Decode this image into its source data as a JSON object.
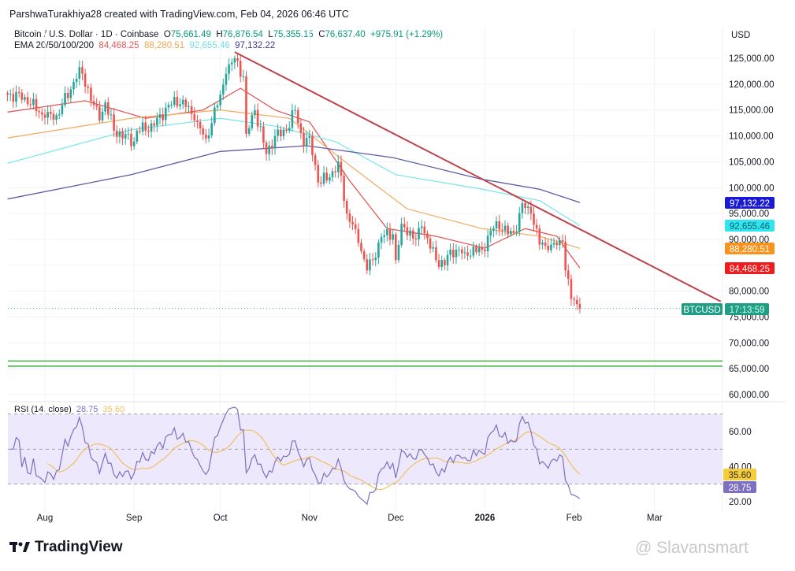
{
  "header": {
    "credit": "ParshwaTurakhiya28 created with TradingView.com, Feb 04, 2026 06:46 UTC"
  },
  "legend": {
    "symbol": "Bitcoin / U.S. Dollar · 1D · Coinbase",
    "o_label": "O",
    "o": "75,661.49",
    "h_label": "H",
    "h": "76,876.54",
    "l_label": "L",
    "l": "75,355.15",
    "c_label": "C",
    "c": "76,637.40",
    "change": "+975.91 (+1.29%)",
    "ema_label": "EMA 20/50/100/200",
    "ema20": "84,468.25",
    "ema50": "88,280.51",
    "ema100": "92,655.46",
    "ema200": "97,132.22"
  },
  "rsi_legend": {
    "label": "RSI (14, close)",
    "rsi": "28.75",
    "ma": "35.60"
  },
  "price_axis": {
    "currency": "USD",
    "ticks": [
      "125,000.00",
      "120,000.00",
      "115,000.00",
      "110,000.00",
      "105,000.00",
      "100,000.00",
      "95,000.00",
      "90,000.00",
      "80,000.00",
      "75,000.00",
      "70,000.00",
      "65,000.00",
      "60,000.00"
    ],
    "badges": {
      "ema200": "97,132.22",
      "ema100": "92,655.46",
      "ema50": "88,280.51",
      "ema20": "84,468.25",
      "symbol": "BTCUSD",
      "countdown": "17:13:59"
    }
  },
  "rsi_axis": {
    "ticks": [
      "60.00",
      "40.00",
      "20.00"
    ],
    "badges": {
      "ma": "35.60",
      "rsi": "28.75"
    }
  },
  "time_axis": {
    "labels": [
      "Aug",
      "Sep",
      "Oct",
      "Nov",
      "Dec",
      "2026",
      "Feb",
      "Mar"
    ]
  },
  "branding": {
    "logo": "TradingView",
    "watermark": "@ Slavansmart"
  },
  "colors": {
    "up": "#26a69a",
    "down": "#ef5350",
    "ema20": "#e05a5a",
    "ema50": "#f2b06a",
    "ema100": "#7fe6ea",
    "ema200": "#5c5aa6",
    "trendline": "#c0404a",
    "support": "#3cb043",
    "rsi": "#7e6fc0",
    "rsi_ma": "#f0c060",
    "rsi_bg": "#ede8fb"
  },
  "chart_data": [
    {
      "type": "candlestick",
      "title": "Bitcoin / U.S. Dollar · 1D · Coinbase",
      "ylabel": "USD",
      "ylim": [
        60000,
        127000
      ],
      "grid": true,
      "close_keypoints": [
        [
          "2025-07-19",
          118000
        ],
        [
          "2025-07-25",
          117500
        ],
        [
          "2025-08-01",
          113500
        ],
        [
          "2025-08-05",
          114000
        ],
        [
          "2025-08-10",
          119000
        ],
        [
          "2025-08-13",
          123300
        ],
        [
          "2025-08-18",
          116000
        ],
        [
          "2025-08-20",
          113000
        ],
        [
          "2025-08-22",
          116500
        ],
        [
          "2025-08-25",
          111000
        ],
        [
          "2025-09-01",
          108900
        ],
        [
          "2025-09-02",
          111000
        ],
        [
          "2025-09-08",
          112000
        ],
        [
          "2025-09-13",
          116000
        ],
        [
          "2025-09-18",
          117000
        ],
        [
          "2025-09-22",
          113000
        ],
        [
          "2025-09-26",
          109500
        ],
        [
          "2025-10-01",
          118000
        ],
        [
          "2025-10-03",
          122000
        ],
        [
          "2025-10-06",
          125000
        ],
        [
          "2025-10-09",
          121500
        ],
        [
          "2025-10-10",
          110400
        ],
        [
          "2025-10-13",
          115000
        ],
        [
          "2025-10-17",
          106500
        ],
        [
          "2025-10-20",
          110000
        ],
        [
          "2025-10-24",
          111000
        ],
        [
          "2025-10-27",
          115000
        ],
        [
          "2025-10-30",
          108000
        ],
        [
          "2025-11-01",
          110000
        ],
        [
          "2025-11-04",
          101000
        ],
        [
          "2025-11-08",
          102000
        ],
        [
          "2025-11-11",
          105000
        ],
        [
          "2025-11-14",
          95000
        ],
        [
          "2025-11-17",
          92000
        ],
        [
          "2025-11-21",
          84000
        ],
        [
          "2025-11-23",
          86000
        ],
        [
          "2025-11-26",
          90500
        ],
        [
          "2025-11-30",
          91000
        ],
        [
          "2025-12-01",
          86000
        ],
        [
          "2025-12-03",
          93000
        ],
        [
          "2025-12-08",
          90000
        ],
        [
          "2025-12-10",
          92500
        ],
        [
          "2025-12-15",
          86000
        ],
        [
          "2025-12-18",
          85000
        ],
        [
          "2025-12-20",
          88000
        ],
        [
          "2025-12-25",
          87500
        ],
        [
          "2025-12-31",
          88000
        ],
        [
          "2026-01-05",
          93500
        ],
        [
          "2026-01-09",
          91000
        ],
        [
          "2026-01-12",
          91500
        ],
        [
          "2026-01-14",
          97000
        ],
        [
          "2026-01-17",
          95000
        ],
        [
          "2026-01-20",
          89000
        ],
        [
          "2026-01-24",
          89000
        ],
        [
          "2026-01-28",
          89500
        ],
        [
          "2026-01-29",
          84000
        ],
        [
          "2026-01-31",
          78500
        ],
        [
          "2026-02-02",
          77500
        ],
        [
          "2026-02-03",
          76637.4
        ]
      ],
      "ema": [
        {
          "name": "EMA 20",
          "points": [
            [
              "2025-07-19",
              114600
            ],
            [
              "2025-08-15",
              116800
            ],
            [
              "2025-09-05",
              113400
            ],
            [
              "2025-09-25",
              115000
            ],
            [
              "2025-10-08",
              119200
            ],
            [
              "2025-10-20",
              115000
            ],
            [
              "2025-11-01",
              112700
            ],
            [
              "2025-11-15",
              101300
            ],
            [
              "2025-11-28",
              92100
            ],
            [
              "2025-12-15",
              90600
            ],
            [
              "2026-01-01",
              88300
            ],
            [
              "2026-01-15",
              92100
            ],
            [
              "2026-01-26",
              90600
            ],
            [
              "2026-02-03",
              84468.25
            ]
          ]
        },
        {
          "name": "EMA 50",
          "points": [
            [
              "2025-07-19",
              109600
            ],
            [
              "2025-08-31",
              113400
            ],
            [
              "2025-10-01",
              115000
            ],
            [
              "2025-10-25",
              113400
            ],
            [
              "2025-11-15",
              104300
            ],
            [
              "2025-12-05",
              95900
            ],
            [
              "2025-12-31",
              92100
            ],
            [
              "2026-01-20",
              90600
            ],
            [
              "2026-02-03",
              88280.51
            ]
          ]
        },
        {
          "name": "EMA 100",
          "points": [
            [
              "2025-07-19",
              104700
            ],
            [
              "2025-08-31",
              111200
            ],
            [
              "2025-10-01",
              113400
            ],
            [
              "2025-10-20",
              111900
            ],
            [
              "2025-11-10",
              108900
            ],
            [
              "2025-12-01",
              102500
            ],
            [
              "2025-12-31",
              99700
            ],
            [
              "2026-01-20",
              97500
            ],
            [
              "2026-02-03",
              92655.46
            ]
          ]
        },
        {
          "name": "EMA 200",
          "points": [
            [
              "2025-07-19",
              97800
            ],
            [
              "2025-08-31",
              102500
            ],
            [
              "2025-10-01",
              107000
            ],
            [
              "2025-10-31",
              108100
            ],
            [
              "2025-11-30",
              105800
            ],
            [
              "2025-12-31",
              101600
            ],
            [
              "2026-01-20",
              99700
            ],
            [
              "2026-02-03",
              97132.22
            ]
          ]
        }
      ],
      "trendline": [
        [
          "2025-10-06",
          126200
        ],
        [
          "2026-03-24",
          78000
        ]
      ],
      "support_levels": [
        66500,
        65500
      ],
      "last_price": 76637.4
    },
    {
      "type": "line",
      "title": "RSI (14, close)",
      "ylim": [
        15,
        75
      ],
      "bands": [
        30,
        50,
        70
      ],
      "last_rsi": 28.75,
      "last_ma": 35.6
    }
  ]
}
